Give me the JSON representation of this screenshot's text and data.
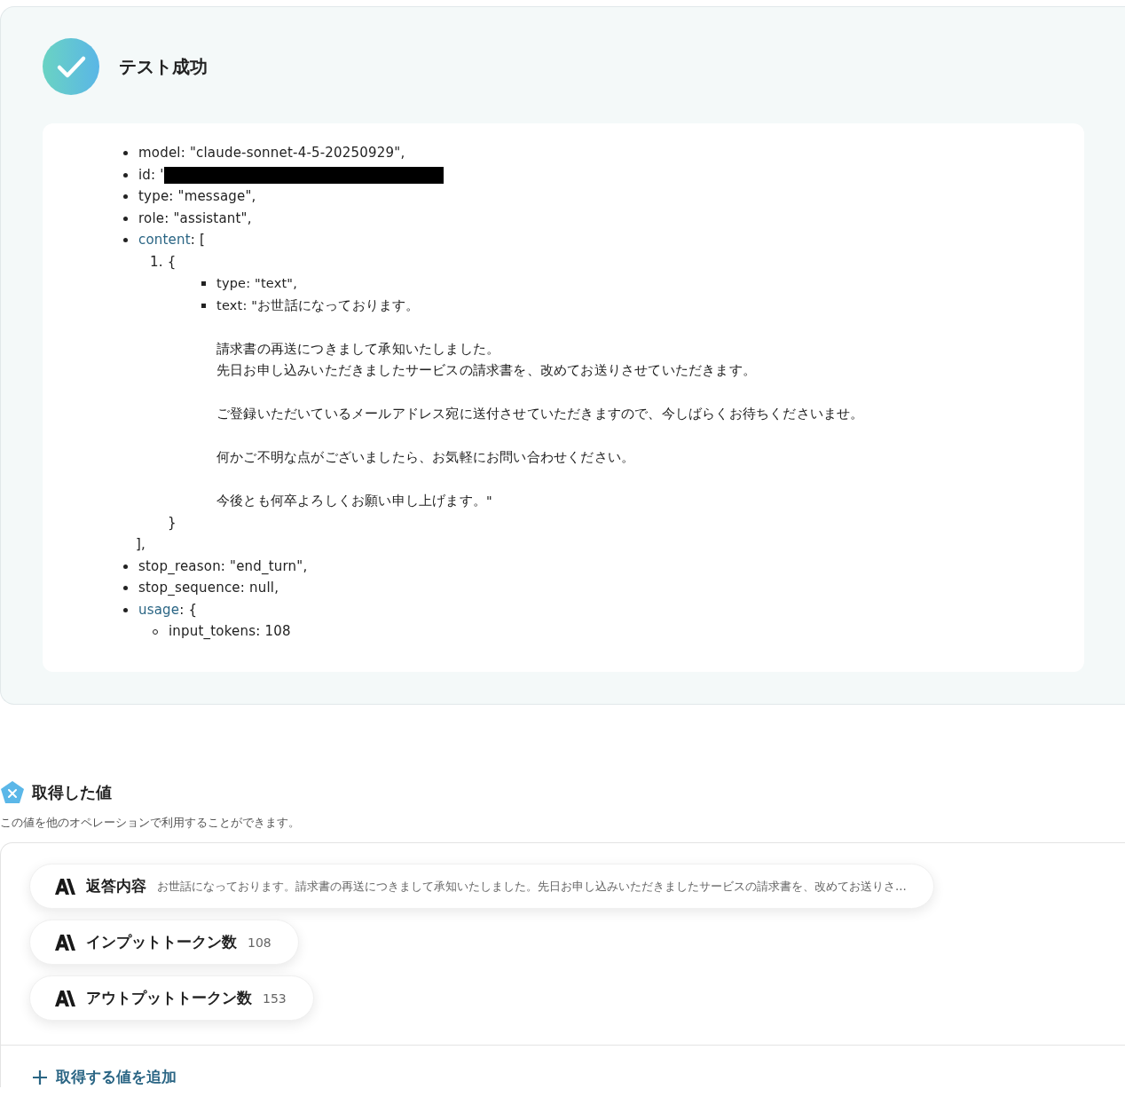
{
  "result": {
    "passed": true,
    "title": "テスト成功",
    "items": [
      {
        "kind": "field",
        "text": "model: \"claude-sonnet-4-5-20250929\","
      },
      {
        "kind": "redacted",
        "text": "id: '"
      },
      {
        "kind": "field",
        "text": "type: \"message\","
      },
      {
        "kind": "field",
        "text": "role: \"assistant\","
      },
      {
        "kind": "group",
        "key": "content",
        "open": ": [",
        "close": "],",
        "entries": [
          {
            "open": "1. {",
            "close": "}",
            "fields": [
              {
                "text": "type: \"text\","
              },
              {
                "text": "text: \"お世話になっております。",
                "paragraphs": [
                  [
                    "請求書の再送につきまして承知いたしました。",
                    "先日お申し込みいただきましたサービスの請求書を、改めてお送りさせていただきます。"
                  ],
                  [
                    "ご登録いただいているメールアドレス宛に送付させていただきますので、今しばらくお待ちくださいませ。"
                  ],
                  [
                    "何かご不明な点がございましたら、お気軽にお問い合わせください。"
                  ],
                  [
                    "今後とも何卒よろしくお願い申し上げます。\""
                  ]
                ]
              }
            ]
          }
        ]
      },
      {
        "kind": "field",
        "text": "stop_reason: \"end_turn\","
      },
      {
        "kind": "field",
        "text": "stop_sequence: null,"
      },
      {
        "kind": "object",
        "key": "usage",
        "open": ": {",
        "fields": [
          {
            "text": "input_tokens: 108"
          }
        ]
      }
    ]
  },
  "values": {
    "title": "取得した値",
    "description": "この値を他のオペレーションで利用することができます。",
    "items": [
      {
        "label": "返答内容",
        "value": "お世話になっております。請求書の再送につきまして承知いたしました。先日お申し込みいただきましたサービスの請求書を、改めてお送りさ..."
      },
      {
        "label": "インプットトークン数",
        "value": "108"
      },
      {
        "label": "アウトプットトークン数",
        "value": "153"
      }
    ],
    "add_button": "取得する値を追加"
  }
}
